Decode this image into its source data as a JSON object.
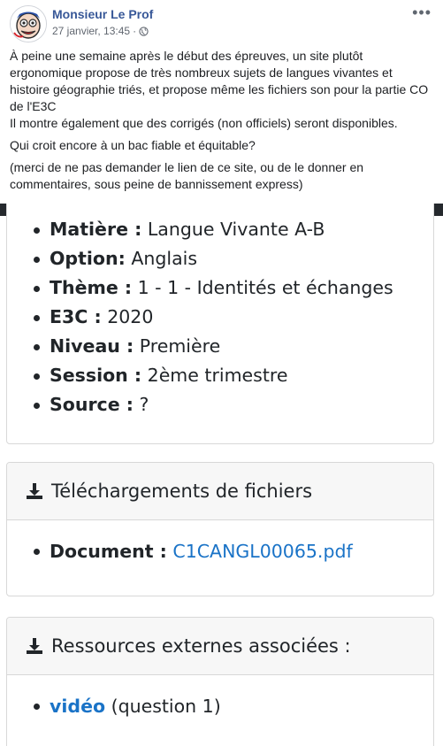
{
  "post": {
    "author": "Monsieur Le Prof",
    "timestamp": "27 janvier, 13:45",
    "separator": "·",
    "audience_icon": "globe-icon",
    "more_icon": "more-options-icon",
    "more_label": "•••",
    "paragraphs": [
      "À peine une semaine après le début des épreuves, un site plutôt ergonomique propose de très nombreux sujets de langues vivantes et histoire géographie triés, et propose même les fichiers son pour la partie CO de l'E3C",
      "Il montre également que des corrigés (non officiels) seront disponibles.",
      "Qui croit encore à un bac fiable et équitable?",
      "(merci de ne pas demander le lien de ce site, ou de le donner en commentaires, sous peine de bannissement express)"
    ]
  },
  "screenshot": {
    "details": [
      {
        "label": "Matière :",
        "value": "Langue Vivante A-B"
      },
      {
        "label": "Option:",
        "value": "Anglais"
      },
      {
        "label": "Thème :",
        "value": "1 - 1 - Identités et échanges"
      },
      {
        "label": "E3C :",
        "value": "2020"
      },
      {
        "label": "Niveau :",
        "value": "Première"
      },
      {
        "label": "Session :",
        "value": "2ème trimestre"
      },
      {
        "label": "Source :",
        "value": "?"
      }
    ],
    "downloads": {
      "title": "Téléchargements de fichiers",
      "icon": "download-icon",
      "document_label": "Document :",
      "document_link": "C1CANGL00065.pdf"
    },
    "resources": {
      "title": "Ressources externes associées :",
      "icon": "download-icon",
      "link": "vidéo",
      "link_note": "(question 1)"
    }
  },
  "colors": {
    "author": "#385898",
    "link": "#1a73c7",
    "topbar": "#25292d"
  }
}
